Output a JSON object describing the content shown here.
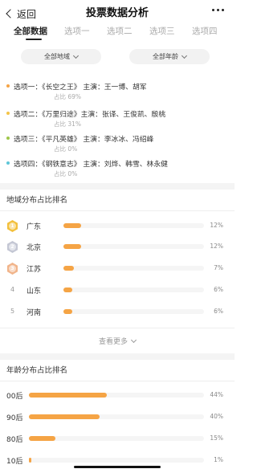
{
  "nav": {
    "back_label": "返回",
    "title": "投票数据分析"
  },
  "tabs": [
    {
      "label": "全部数据",
      "active": true
    },
    {
      "label": "选项一",
      "active": false
    },
    {
      "label": "选项二",
      "active": false
    },
    {
      "label": "选项三",
      "active": false
    },
    {
      "label": "选项四",
      "active": false
    }
  ],
  "filters": {
    "region": "全部地域",
    "age": "全部年龄"
  },
  "options": [
    {
      "text": "选项一：《长空之王》 主演：王一博、胡军",
      "share": "占比 69%",
      "color": "#f5a445"
    },
    {
      "text": "选项二：《万里归途》主演：张译、王俊凯、殷桃",
      "share": "占比 31%",
      "color": "#f3c449"
    },
    {
      "text": "选项三：《平凡英雄》 主演：李冰冰、冯绍峰",
      "share": "占比 0%",
      "color": "#9fc74a"
    },
    {
      "text": "选项四：《钢铁意志》 主演：刘烨、韩雪、林永健",
      "share": "占比 0%",
      "color": "#5ec6d8"
    }
  ],
  "region_section": {
    "title": "地域分布占比排名",
    "rows": [
      {
        "rank": "1",
        "name": "广东",
        "pct_label": "12%",
        "value": 12,
        "medal_color": "#f3c03c"
      },
      {
        "rank": "2",
        "name": "北京",
        "pct_label": "12%",
        "value": 12,
        "medal_color": "#c4c7d4"
      },
      {
        "rank": "3",
        "name": "江苏",
        "pct_label": "7%",
        "value": 7,
        "medal_color": "#f1b48a"
      },
      {
        "rank": "4",
        "name": "山东",
        "pct_label": "6%",
        "value": 6,
        "medal_color": ""
      },
      {
        "rank": "5",
        "name": "河南",
        "pct_label": "6%",
        "value": 6,
        "medal_color": ""
      }
    ],
    "bar_color": "#f5a445",
    "see_more": "查看更多"
  },
  "age_section": {
    "title": "年龄分布占比排名",
    "rows": [
      {
        "name": "00后",
        "pct_label": "44%",
        "value": 44
      },
      {
        "name": "90后",
        "pct_label": "40%",
        "value": 40
      },
      {
        "name": "80后",
        "pct_label": "15%",
        "value": 15
      },
      {
        "name": "10后",
        "pct_label": "1%",
        "value": 1
      }
    ]
  }
}
